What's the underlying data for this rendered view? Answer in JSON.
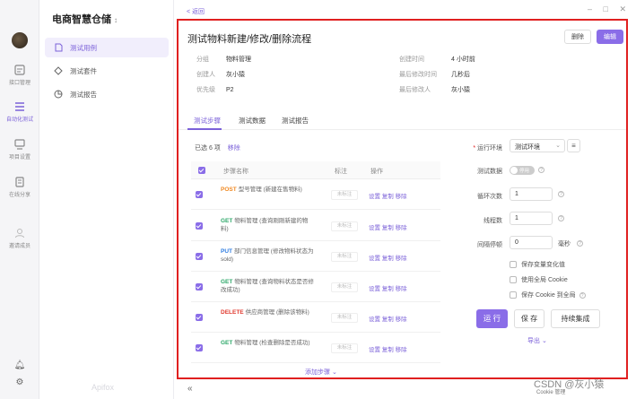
{
  "rail": {
    "items": [
      {
        "label": "接口管理",
        "icon": "api-icon"
      },
      {
        "label": "自动化测试",
        "icon": "automation-icon"
      },
      {
        "label": "项目设置",
        "icon": "settings-icon"
      },
      {
        "label": "在线分享",
        "icon": "share-icon"
      },
      {
        "label": "邀请成员",
        "icon": "invite-icon"
      }
    ]
  },
  "sidebar": {
    "project": "电商智慧仓储",
    "items": [
      {
        "label": "测试用例",
        "icon": "file-icon"
      },
      {
        "label": "测试套件",
        "icon": "suite-icon"
      },
      {
        "label": "测试报告",
        "icon": "report-icon"
      }
    ],
    "brand": "Apifox"
  },
  "header": {
    "back": "< 返回",
    "title": "测试物料新建/修改/删除流程",
    "delete": "删除",
    "edit": "编辑"
  },
  "meta": {
    "group_k": "分组",
    "group_v": "物料管理",
    "creator_k": "创建人",
    "creator_v": "灰小猿",
    "priority_k": "优先级",
    "priority_v": "P2",
    "created_k": "创建时间",
    "created_v": "4 小时前",
    "modified_k": "最后修改时间",
    "modified_v": "几秒后",
    "modifier_k": "最后修改人",
    "modifier_v": "灰小猿"
  },
  "tabs": [
    "测试步骤",
    "测试数据",
    "测试报告"
  ],
  "steps": {
    "selected": "已选 6 项",
    "remove": "移除",
    "col_name": "步骤名称",
    "col_anno": "标注",
    "col_ops": "操作",
    "annotation_placeholder": "未标注",
    "ops": "设置 复制 移除",
    "rows": [
      {
        "method": "POST",
        "cls": "m-post",
        "text": "型号管理 (新建在售物料)"
      },
      {
        "method": "GET",
        "cls": "m-get",
        "text": "物料管理 (查询刚刚新建的物料)"
      },
      {
        "method": "PUT",
        "cls": "m-put",
        "text": "部门信息管理 (修改物料状态为 sold)"
      },
      {
        "method": "GET",
        "cls": "m-get",
        "text": "物料管理 (查询物料状态是否修改成功)"
      },
      {
        "method": "DELETE",
        "cls": "m-del",
        "text": "供应商管理 (删除该物料)"
      },
      {
        "method": "GET",
        "cls": "m-get",
        "text": "物料管理 (检查删除是否成功)"
      }
    ],
    "add": "添加步骤 ⌄"
  },
  "form": {
    "env_label": "运行环境",
    "env_value": "测试环境",
    "data_label": "测试数据",
    "data_toggle": "停用",
    "loops_label": "循环次数",
    "loops_value": "1",
    "threads_label": "线程数",
    "threads_value": "1",
    "interval_label": "间隔停顿",
    "interval_value": "0",
    "interval_unit": "毫秒",
    "opt1": "保存变量变化值",
    "opt2": "使用全局 Cookie",
    "opt3": "保存 Cookie 到全局",
    "run": "运 行",
    "save": "保 存",
    "ci": "持续集成",
    "export": "导出 ⌄"
  },
  "footer": {
    "collapse": "«",
    "cookie": "Cookie 管理",
    "watermark": "CSDN @灰小猿"
  }
}
